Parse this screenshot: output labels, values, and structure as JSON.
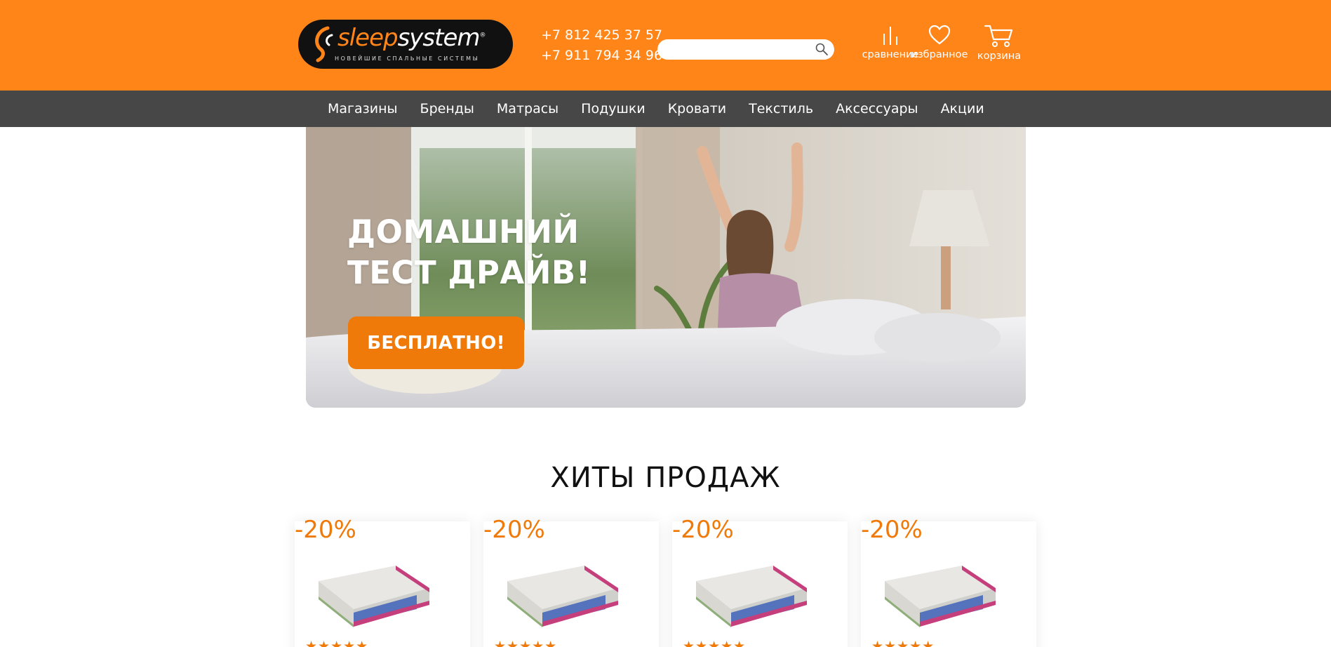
{
  "header": {
    "logo": {
      "word_part1": "sleep",
      "word_part2": "system",
      "registered": "®",
      "tagline": "НОВЕЙШИЕ СПАЛЬНЫЕ СИСТЕМЫ"
    },
    "phones": [
      "+7 812 425 37 57",
      "+7 911 794 34 96"
    ],
    "search": {
      "placeholder": "",
      "value": "",
      "icon": "search-icon"
    },
    "links": {
      "compare": {
        "label": "сравнение",
        "icon": "compare-bars-icon"
      },
      "favorites": {
        "label": "избранное",
        "icon": "heart-icon"
      },
      "cart": {
        "label": "корзина",
        "icon": "cart-icon"
      }
    },
    "colors": {
      "brand_orange": "#ff8519",
      "nav_bg": "#474747",
      "accent": "#ef7a0a"
    }
  },
  "nav": {
    "items": [
      "Магазины",
      "Бренды",
      "Матрасы",
      "Подушки",
      "Кровати",
      "Текстиль",
      "Аксессуары",
      "Акции"
    ]
  },
  "hero": {
    "title_line1": "ДОМАШНИЙ",
    "title_line2": "ТЕСТ ДРАЙВ!",
    "cta": "БЕСПЛАТНО!"
  },
  "bestsellers": {
    "title": "ХИТЫ ПРОДАЖ",
    "cards": [
      {
        "discount": "-20%",
        "stars": "★★★★★",
        "rating": 5
      },
      {
        "discount": "-20%",
        "stars": "★★★★★",
        "rating": 5
      },
      {
        "discount": "-20%",
        "stars": "★★★★★",
        "rating": 5
      },
      {
        "discount": "-20%",
        "stars": "★★★★★",
        "rating": 5
      }
    ]
  }
}
